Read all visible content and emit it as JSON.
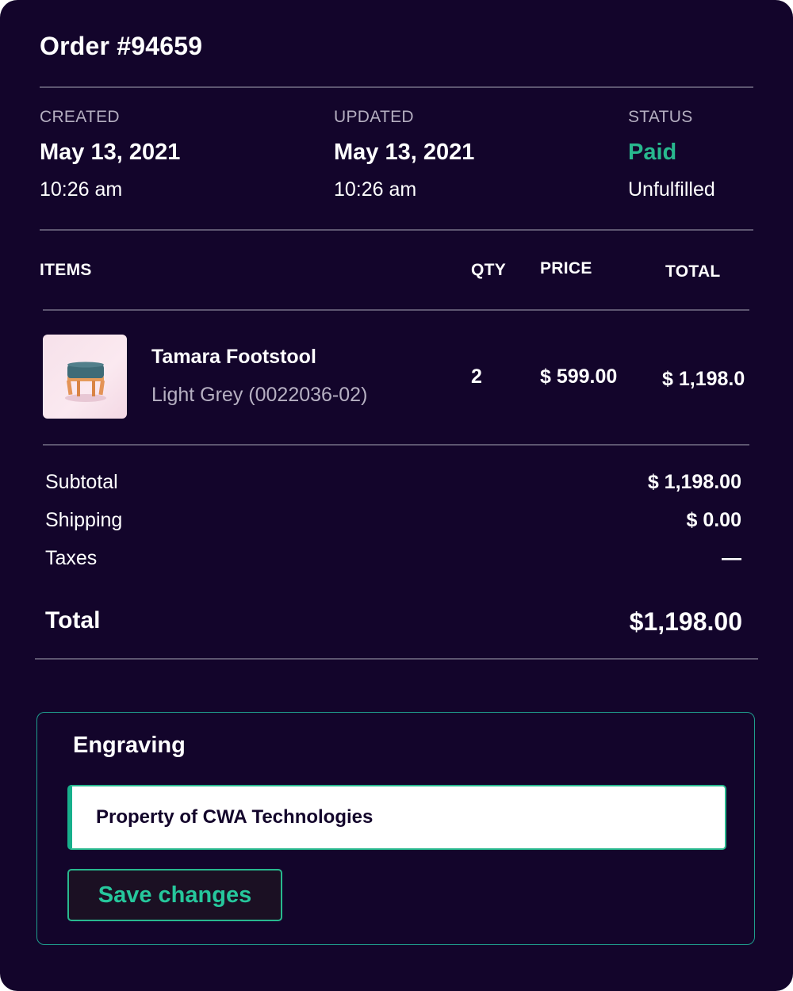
{
  "order": {
    "title": "Order #94659"
  },
  "meta": {
    "created": {
      "label": "CREATED",
      "date": "May 13, 2021",
      "time": "10:26 am"
    },
    "updated": {
      "label": "UPDATED",
      "date": "May 13, 2021",
      "time": "10:26 am"
    },
    "status": {
      "label": "STATUS",
      "payment": "Paid",
      "fulfillment": "Unfulfilled"
    }
  },
  "table": {
    "headers": {
      "items": "ITEMS",
      "qty": "QTY",
      "price": "PRICE",
      "total": "TOTAL"
    },
    "rows": [
      {
        "name": "Tamara Footstool",
        "variant": "Light Grey (0022036-02)",
        "qty": "2",
        "price": "$ 599.00",
        "total": "$ 1,198.0",
        "image_icon": "footstool-product-image"
      }
    ]
  },
  "summary": {
    "subtotal_label": "Subtotal",
    "subtotal_value": "$ 1,198.00",
    "shipping_label": "Shipping",
    "shipping_value": "$ 0.00",
    "taxes_label": "Taxes",
    "taxes_value": "—",
    "total_label": "Total",
    "total_value": "$1,198.00"
  },
  "engraving": {
    "title": "Engraving",
    "value": "Property of CWA Technologies",
    "save_label": "Save changes"
  },
  "colors": {
    "background": "#13052b",
    "accent": "#28b88e",
    "divider": "#5d5670",
    "muted_text": "#b4aec0"
  }
}
